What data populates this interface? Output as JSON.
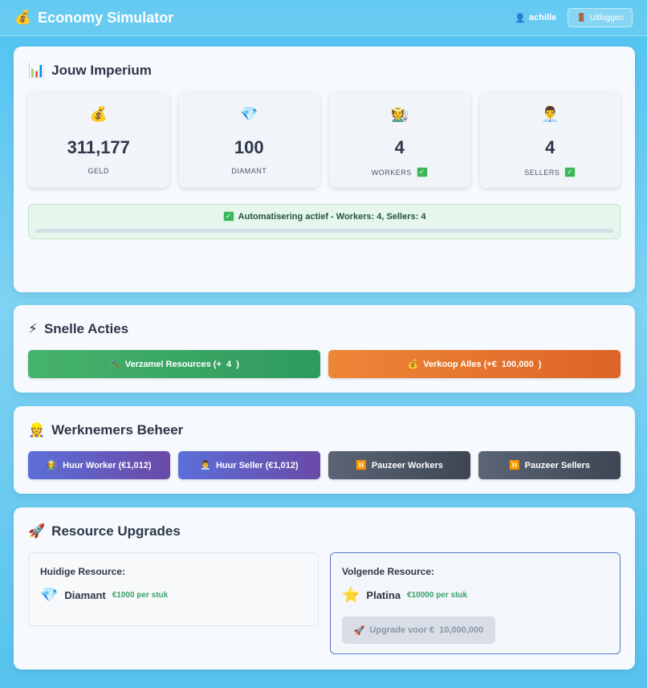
{
  "header": {
    "logo_icon": "💰",
    "title": "Economy Simulator",
    "user_icon": "👤",
    "username": "achille",
    "logout_icon": "🚪",
    "logout_label": "Uitloggen"
  },
  "empire": {
    "title_icon": "📊",
    "title": "Jouw Imperium",
    "stats": [
      {
        "icon": "💰",
        "value": "311,177",
        "label": "GELD",
        "check": ""
      },
      {
        "icon": "💎",
        "value": "100",
        "label": "DIAMANT",
        "check": ""
      },
      {
        "icon": "🧑‍🌾",
        "value": "4",
        "label": "WORKERS",
        "check": "✓"
      },
      {
        "icon": "👨‍💼",
        "value": "4",
        "label": "SELLERS",
        "check": "✓"
      }
    ],
    "automation_icon": "✅",
    "automation_text": "Automatisering actief - Workers: 4, Sellers: 4",
    "automation_progress": 0.0
  },
  "quick": {
    "title_icon": "⚡",
    "title": "Snelle Acties",
    "collect_icon": "⛏️",
    "collect_label": "Verzamel Resources (+  4  )",
    "sell_icon": "💰",
    "sell_label": "Verkoop Alles (+€  100,000  )"
  },
  "staff": {
    "title_icon": "👷",
    "title": "Werknemers Beheer",
    "hire_worker_icon": "🧑‍🌾",
    "hire_worker_label": "Huur Worker (€1,012)",
    "hire_seller_icon": "👨‍💼",
    "hire_seller_label": "Huur Seller (€1,012)",
    "pause_workers_icon": "⏸️",
    "pause_workers_label": "Pauzeer Workers",
    "pause_sellers_icon": "⏸️",
    "pause_sellers_label": "Pauzeer Sellers"
  },
  "upgrades": {
    "title_icon": "🚀",
    "title": "Resource Upgrades",
    "current_heading": "Huidige Resource:",
    "current_icon": "💎",
    "current_name": "Diamant",
    "current_price": "€1000 per stuk",
    "next_heading": "Volgende Resource:",
    "next_icon": "⭐",
    "next_name": "Platina",
    "next_price": "€10000 per stuk",
    "upgrade_icon": "🚀",
    "upgrade_label": "Upgrade voor €  10,000,000"
  }
}
